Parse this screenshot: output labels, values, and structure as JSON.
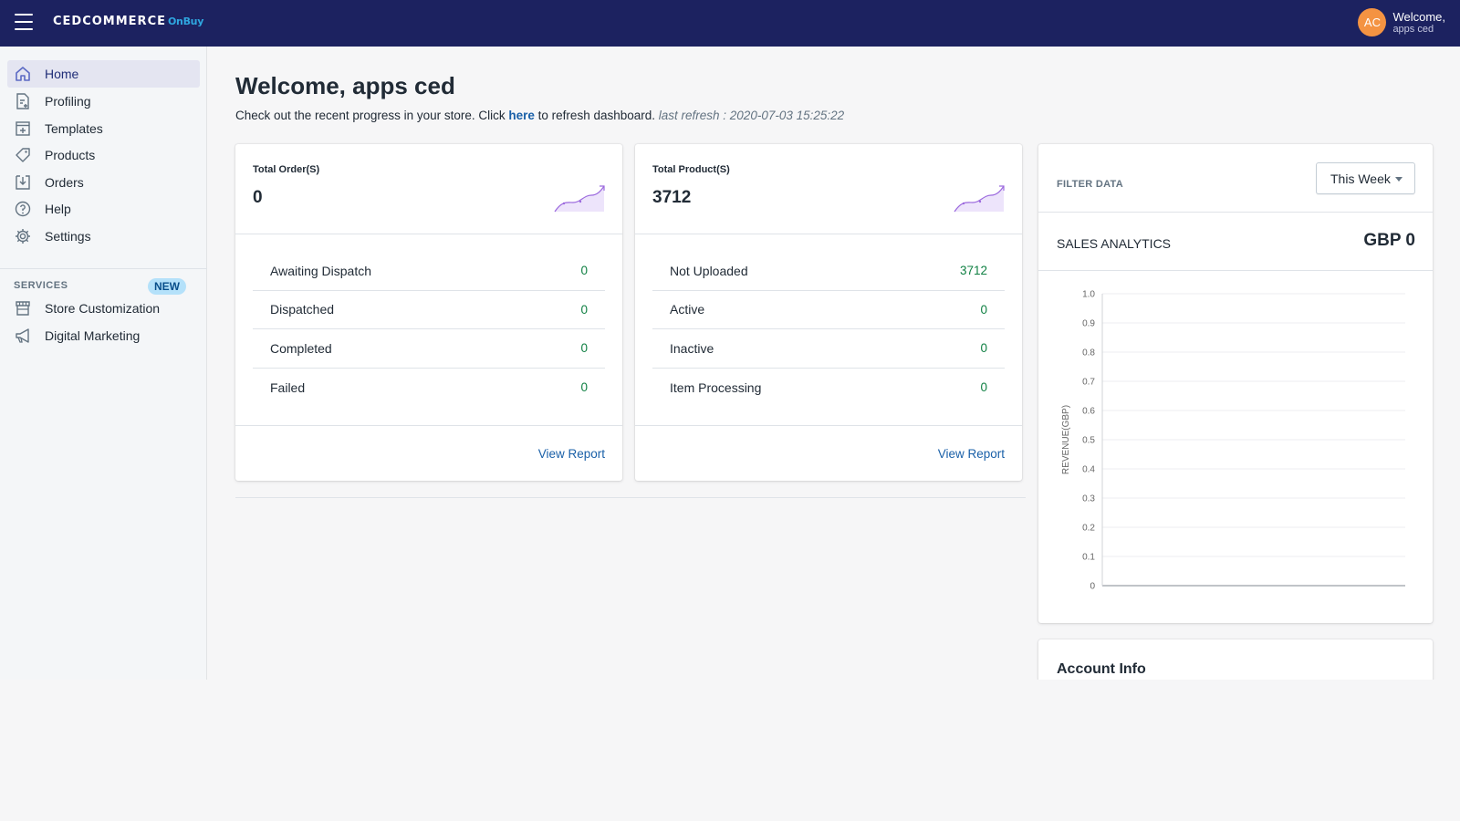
{
  "header": {
    "logo_brand": "CEDCOMMERCE",
    "logo_sub": "OnBuy",
    "avatar_initials": "AC",
    "welcome": "Welcome,",
    "username": "apps ced"
  },
  "sidebar": {
    "items": [
      {
        "label": "Home",
        "icon": "home-icon",
        "active": true
      },
      {
        "label": "Profiling",
        "icon": "profiling-icon"
      },
      {
        "label": "Templates",
        "icon": "templates-icon"
      },
      {
        "label": "Products",
        "icon": "tag-icon"
      },
      {
        "label": "Orders",
        "icon": "download-box-icon"
      },
      {
        "label": "Help",
        "icon": "help-icon"
      },
      {
        "label": "Settings",
        "icon": "gear-icon"
      }
    ],
    "services_title": "SERVICES",
    "services_badge": "NEW",
    "services": [
      {
        "label": "Store Customization",
        "icon": "store-icon"
      },
      {
        "label": "Digital Marketing",
        "icon": "megaphone-icon"
      }
    ]
  },
  "main": {
    "title": "Welcome, apps ced",
    "subtitle_pre": "Check out the recent progress in your store. Click ",
    "subtitle_link": "here",
    "subtitle_post": " to refresh dashboard. ",
    "last_refresh": "last refresh : 2020-07-03 15:25:22"
  },
  "orders_card": {
    "label": "Total Order(S)",
    "value": "0",
    "rows": [
      {
        "label": "Awaiting Dispatch",
        "value": "0"
      },
      {
        "label": "Dispatched",
        "value": "0"
      },
      {
        "label": "Completed",
        "value": "0"
      },
      {
        "label": "Failed",
        "value": "0"
      }
    ],
    "link": "View Report"
  },
  "products_card": {
    "label": "Total Product(S)",
    "value": "3712",
    "rows": [
      {
        "label": "Not Uploaded",
        "value": "3712"
      },
      {
        "label": "Active",
        "value": "0"
      },
      {
        "label": "Inactive",
        "value": "0"
      },
      {
        "label": "Item Processing",
        "value": "0"
      }
    ],
    "link": "View Report"
  },
  "analytics": {
    "filter_label": "FILTER DATA",
    "filter_value": "This Week",
    "sales_label": "SALES ANALYTICS",
    "sales_value": "GBP 0"
  },
  "chart_data": {
    "type": "line",
    "ylabel": "REVENUE(GBP)",
    "ylim": [
      0,
      1.0
    ],
    "yticks": [
      "0",
      "0.1",
      "0.2",
      "0.3",
      "0.4",
      "0.5",
      "0.6",
      "0.7",
      "0.8",
      "0.9",
      "1.0"
    ],
    "grid": true,
    "series": []
  },
  "account": {
    "title": "Account Info"
  },
  "colors": {
    "topbar": "#1c2260",
    "accent_link": "#1a60a8",
    "value_green": "#108043",
    "avatar": "#f49342",
    "new_badge": "#b4e1fa"
  }
}
